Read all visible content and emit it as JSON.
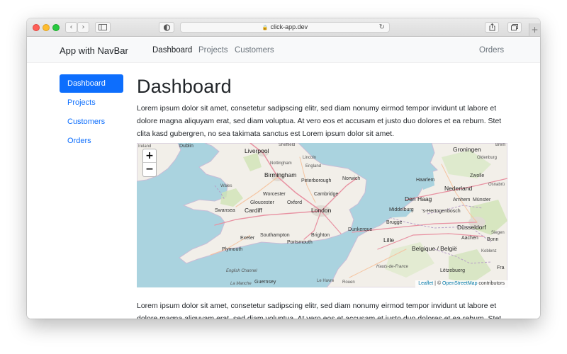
{
  "browser": {
    "url": "click-app.dev",
    "lock_icon": "lock-icon",
    "reload_icon": "reload-icon",
    "back_icon": "‹",
    "forward_icon": "›",
    "new_tab_icon": "+"
  },
  "navbar": {
    "brand": "App with NavBar",
    "links": [
      "Dashboard",
      "Projects",
      "Customers"
    ],
    "right_link": "Orders"
  },
  "sidebar": {
    "items": [
      "Dashboard",
      "Projects",
      "Customers",
      "Orders"
    ],
    "active": "Dashboard"
  },
  "main": {
    "title": "Dashboard",
    "paragraph": "Lorem ipsum dolor sit amet, consetetur sadipscing elitr, sed diam nonumy eirmod tempor invidunt ut labore et dolore magna aliquyam erat, sed diam voluptua. At vero eos et accusam et justo duo dolores et ea rebum. Stet clita kasd gubergren, no sea takimata sanctus est Lorem ipsum dolor sit amet.",
    "paragraph2": "Lorem ipsum dolor sit amet, consetetur sadipscing elitr, sed diam nonumy eirmod tempor invidunt ut labore et dolore magna aliquyam erat, sed diam voluptua. At vero eos et accusam et justo duo dolores et ea rebum. Stet clita kasd gubergren, no sea takimata sanctus est Lorem ipsum dolor sit amet."
  },
  "map": {
    "zoom_in": "+",
    "zoom_out": "−",
    "attribution_leaflet": "Leaflet",
    "attribution_sep": " | © ",
    "attribution_osm": "OpenStreetMap",
    "attribution_rest": " contributors",
    "cities": {
      "ireland": "Ireland",
      "dublin": "Dublin",
      "sheffield": "Sheffield",
      "liverpool": "Liverpool",
      "lincoln": "Lincoln",
      "nottingham": "Nottingham",
      "england": "England",
      "birmingham": "Birmingham",
      "peterborough": "Peterborough",
      "norwich": "Norwich",
      "wales": "Wales",
      "worcester": "Worcester",
      "cambridge": "Cambridge",
      "gloucester": "Gloucester",
      "oxford": "Oxford",
      "swansea": "Swansea",
      "cardiff": "Cardiff",
      "london": "London",
      "exeter": "Exeter",
      "southampton": "Southampton",
      "brighton": "Brighton",
      "portsmouth": "Portsmouth",
      "plymouth": "Plymouth",
      "english_channel": "English Channel",
      "la_manche": "La Manche",
      "guernsey": "Guernsey",
      "le_havre": "Le Havre",
      "rouen": "Rouen",
      "groningen": "Groningen",
      "oldenburg": "Oldenburg",
      "zwolle": "Zwolle",
      "haarlem": "Haarlem",
      "nederland": "Nederland",
      "den_haag": "Den Haag",
      "arnhem": "Arnhem",
      "munster": "Münster",
      "middelburg": "Middelburg",
      "hertogenbosch": "'s-Hertogenbosch",
      "brugge": "Brugge",
      "dusseldorf": "Düsseldorf",
      "dunkerque": "Dunkerque",
      "lille": "Lille",
      "belgique": "Belgique / België",
      "aachen": "Aachen",
      "bonn": "Bonn",
      "koblenz": "Koblenz",
      "siegen": "Siegen",
      "osnabruck": "Osnabrü",
      "brem": "Brem",
      "hauts_de_france": "Hauts-de-France",
      "letzebuerg": "Lëtzebuerg",
      "fra": "Fra"
    }
  }
}
